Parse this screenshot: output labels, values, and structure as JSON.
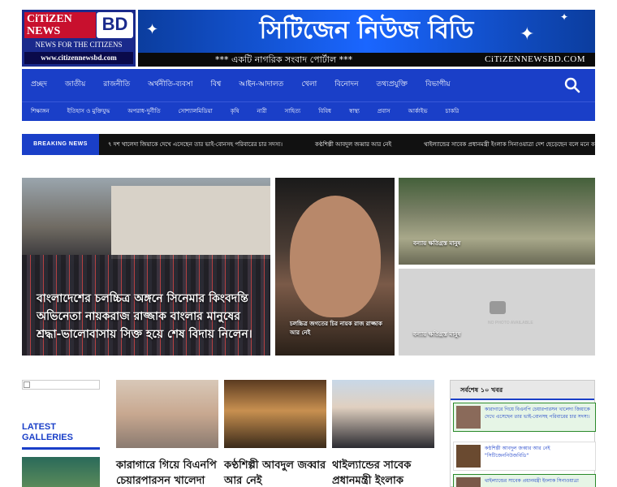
{
  "header": {
    "logo_line1": "CiTiZEN",
    "logo_line2": "NEWS",
    "logo_bd": "BD",
    "logo_tagline": "NEWS FOR THE CITIZENS",
    "logo_url": "www.citizennewsbd.com",
    "banner_title": "সিটিজেন নিউজ বিডি",
    "strip_text": "*** একটি নাগরিক সংবাদ পোর্টাল ***",
    "strip_site": "CiTiZENNEWSBD.COM"
  },
  "nav": {
    "primary": [
      "প্রচ্ছদ",
      "জাতীয়",
      "রাজনীতি",
      "অর্থনীতি-ব্যবসা",
      "বিশ্ব",
      "আইন-আদালত",
      "খেলা",
      "বিনোদন",
      "তথ্যপ্রযুক্তি",
      "বিভাগীয়"
    ],
    "secondary": [
      "শিক্ষাঙ্গন",
      "ইতিহাস ও মুক্তিযুদ্ধ",
      "অপরাধ-দুর্নীতি",
      "সোশ্যালমিডিয়া",
      "কৃষি",
      "নারী",
      "সাহিত্য",
      "বিবিধ",
      "স্বাস্থ্য",
      "প্রবাস",
      "আর্কাইভ",
      "চাকরি"
    ],
    "search_icon": "search-icon"
  },
  "breaking": {
    "label": "BREAKING NEWS",
    "items": [
      "৭ দশ খালেদা জিয়াকে দেখে এসেছেন তার ভাই-বোনসহ পরিবারের চার সদস্য।",
      "কণ্ঠশিল্পী আবদুল জব্বার আর নেই",
      "থাইল্যান্ডের সাবেক প্রধানমন্ত্রী ইংলাক সিনাওয়াত্রা দেশ ছেড়েছেন বলে মনে করছে"
    ]
  },
  "featured": {
    "main_caption": "বাংলাদেশের চলচ্চিত্র অঙ্গনে সিনেমার কিংবদন্তি অভিনেতা নায়করাজ রাজ্জাক বাংলার মানুষের শ্রদ্ধা-ভালোবাসায় সিক্ত হয়ে শেষ বিদায় নিলেন।",
    "second_caption": "চলচ্চিত্র জগতের চির নায়ক রাজ রাজ্জাক আর নেই",
    "third_caption": "বন্যায় ক্ষতিগ্রস্ত মানুষ",
    "fourth_caption": "বন্যায় ক্ষতিগ্রস্ত মানুষ",
    "no_photo": "NO PHOTO AVAILABLE"
  },
  "left_sidebar": {
    "galleries_title_1": "LATEST",
    "galleries_title_2": "GALLERIES"
  },
  "cards": [
    {
      "title": "কারাগারে গিয়ে বিএনপি চেয়ারপারসন খালেদা জিয়াকে"
    },
    {
      "title": "কণ্ঠশিল্পী আবদুল জব্বার আর নেই"
    },
    {
      "title": "থাইল্যান্ডের সাবেক প্রধানমন্ত্রী ইংলাক"
    }
  ],
  "top10": {
    "title": "সর্বশেষ ১০ খবর",
    "items": [
      "কারাগারে গিয়ে বিএনপি চেয়ারপারসন খালেদা জিয়াকে দেখে এসেছেন তার ভাই-বোনসহ পরিবারের চার সদস্য।",
      "কণ্ঠশিল্পী আবদুল জব্বার আর নেই \"সিটিজেননিউজবিডি\"",
      "থাইল্যান্ডের সাবেক প্রধানমন্ত্রী ইংলাক সিনাওয়াত্রা"
    ]
  }
}
